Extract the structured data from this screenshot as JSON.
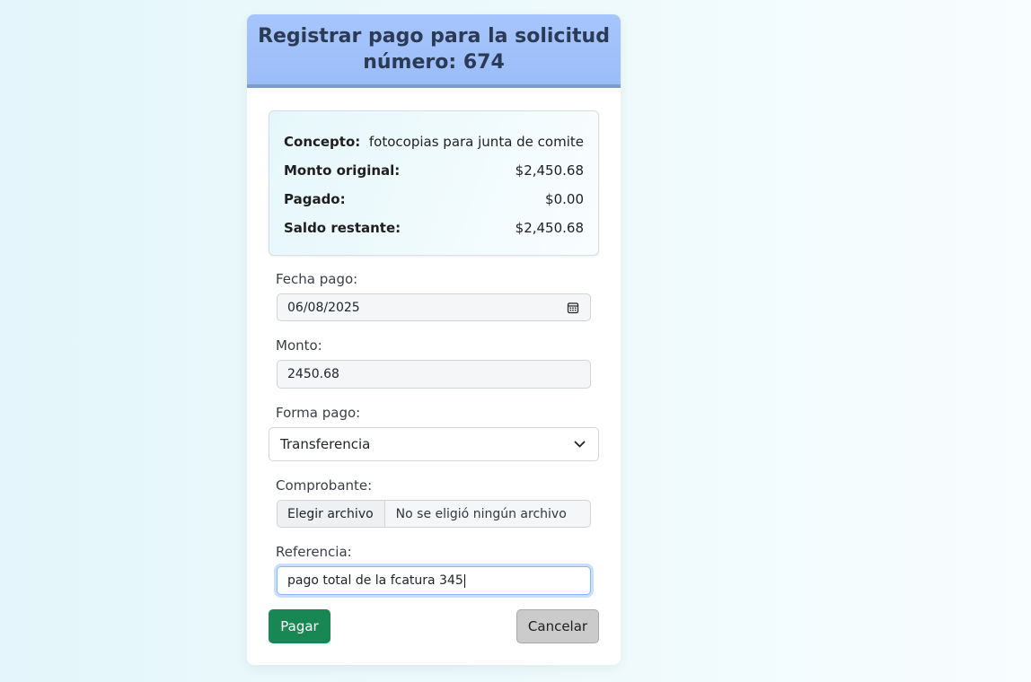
{
  "header": {
    "title_line1": "Registrar pago para la solicitud",
    "title_line2": "número: 674"
  },
  "summary": {
    "concepto_label": "Concepto:",
    "concepto_value": "fotocopias para junta de comite",
    "monto_original_label": "Monto original:",
    "monto_original_value": "$2,450.68",
    "pagado_label": "Pagado:",
    "pagado_value": "$0.00",
    "saldo_label": "Saldo restante:",
    "saldo_value": "$2,450.68"
  },
  "form": {
    "fecha_label": "Fecha pago:",
    "fecha_value": "06/08/2025",
    "monto_label": "Monto:",
    "monto_value": "2450.68",
    "forma_label": "Forma pago:",
    "forma_value": "Transferencia",
    "comprobante_label": "Comprobante:",
    "comprobante_button": "Elegir archivo",
    "comprobante_status": "No se eligió ningún archivo",
    "referencia_label": "Referencia:",
    "referencia_value": "pago total de la fcatura 345"
  },
  "actions": {
    "pay_label": "Pagar",
    "cancel_label": "Cancelar"
  },
  "colors": {
    "header_bg": "#a6c5ff",
    "pay_button": "#198754",
    "cancel_button": "#cbcbcb",
    "focus_ring": "#86b7fe"
  },
  "icons": {
    "date": "calendar-icon",
    "select": "chevron-down-icon"
  }
}
